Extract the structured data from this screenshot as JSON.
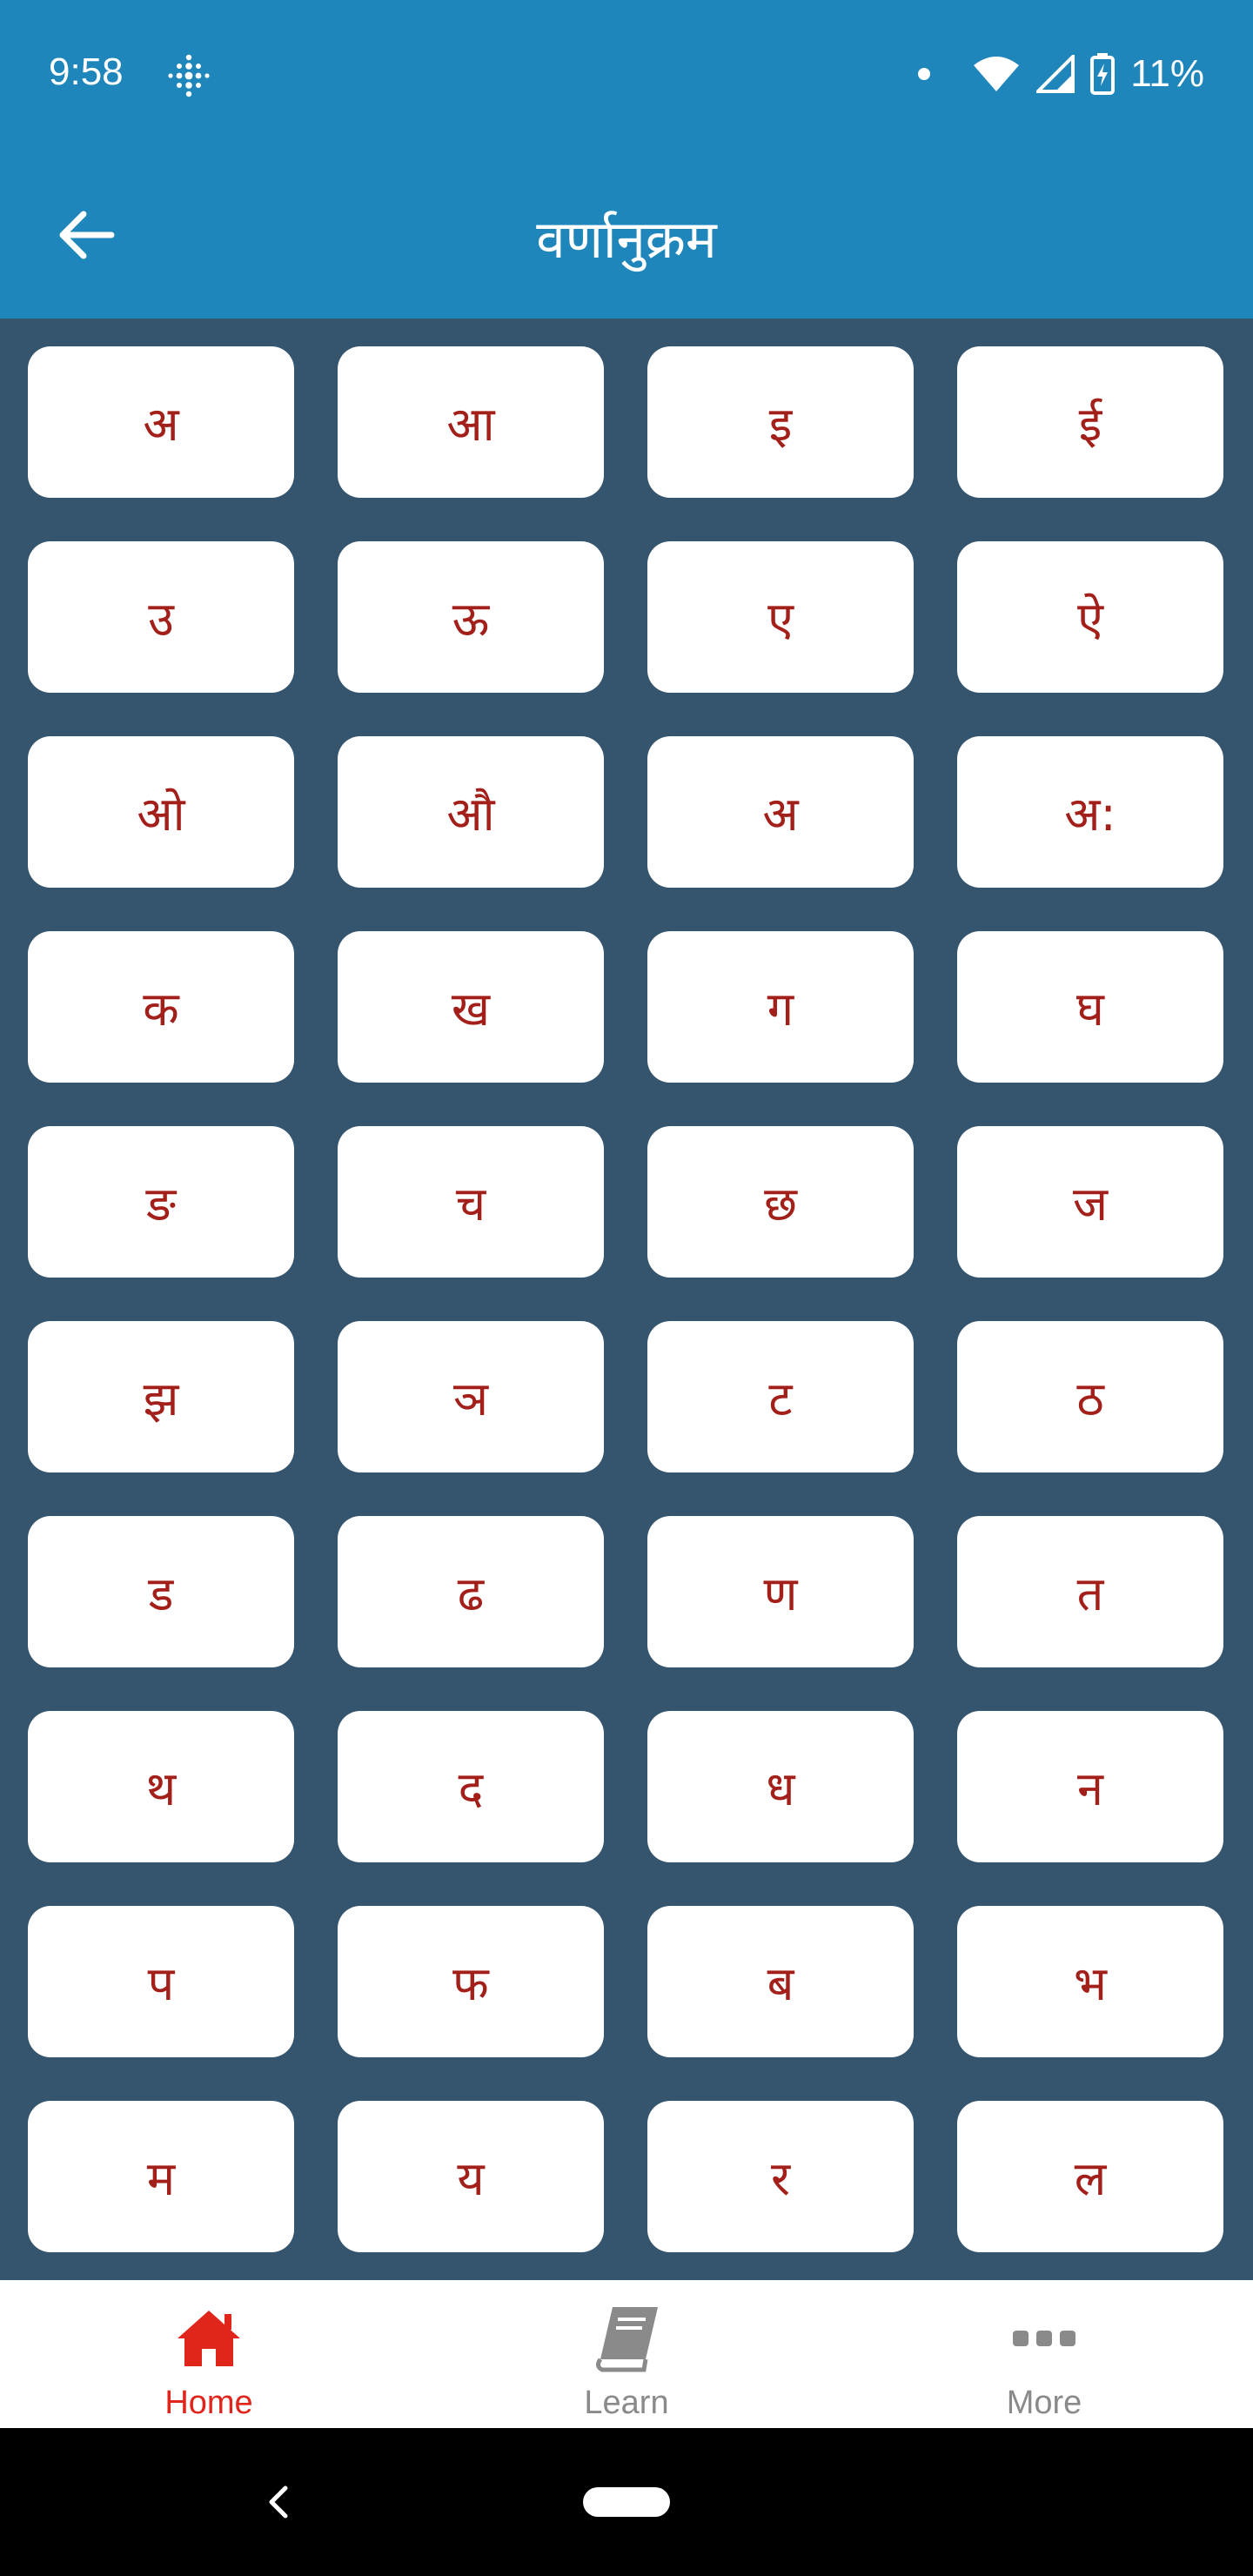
{
  "status_bar": {
    "time": "9:58",
    "battery": "11%",
    "icons": [
      "fitbit-icon",
      "notification-dot",
      "wifi-icon",
      "signal-icon",
      "battery-charging-icon"
    ]
  },
  "app_bar": {
    "title": "वर्णानुक्रम",
    "back_icon": "arrow-left-icon"
  },
  "letters": [
    "अ",
    "आ",
    "इ",
    "ई",
    "उ",
    "ऊ",
    "ए",
    "ऐ",
    "ओ",
    "औ",
    "अ",
    "अ:",
    "क",
    "ख",
    "ग",
    "घ",
    "ङ",
    "च",
    "छ",
    "ज",
    "झ",
    "ञ",
    "ट",
    "ठ",
    "ड",
    "ढ",
    "ण",
    "त",
    "थ",
    "द",
    "ध",
    "न",
    "प",
    "फ",
    "ब",
    "भ",
    "म",
    "य",
    "र",
    "ल"
  ],
  "bottom_nav": {
    "items": [
      {
        "label": "Home",
        "icon": "home-icon",
        "active": true
      },
      {
        "label": "Learn",
        "icon": "book-icon",
        "active": false
      },
      {
        "label": "More",
        "icon": "more-icon",
        "active": false
      }
    ]
  },
  "colors": {
    "primary": "#1e86ba",
    "background": "#34556d",
    "letter": "#a3201a",
    "active_nav": "#e0251b",
    "inactive_nav": "#8a8a8a"
  }
}
